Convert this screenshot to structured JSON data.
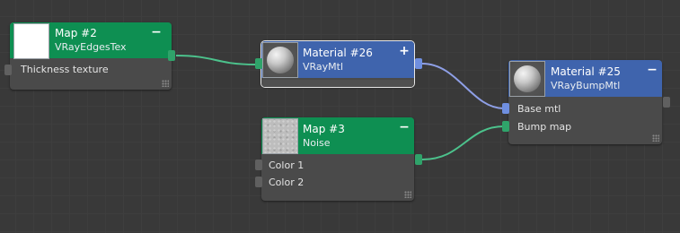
{
  "colors": {
    "canvas": "#393939",
    "node_body": "#4a4a4a",
    "map_header": "#0e8f52",
    "material_header": "#3f64ad",
    "wire_green": "#4cc28c",
    "wire_blue": "#8e9fe6"
  },
  "nodes": {
    "map2": {
      "title": "Map #2",
      "type": "VRayEdgesTex",
      "collapse_symbol": "−",
      "slots": [
        "Thickness texture"
      ],
      "thumbnail": "white-swatch"
    },
    "material26": {
      "title": "Material #26",
      "type": "VRayMtl",
      "expand_symbol": "+",
      "thumbnail": "sphere-preview"
    },
    "map3": {
      "title": "Map #3",
      "type": "Noise",
      "collapse_symbol": "−",
      "slots": [
        "Color 1",
        "Color 2"
      ],
      "thumbnail": "noise-swatch"
    },
    "material25": {
      "title": "Material #25",
      "type": "VRayBumpMtl",
      "collapse_symbol": "−",
      "slots": [
        "Base mtl",
        "Bump map"
      ],
      "thumbnail": "sphere-preview"
    }
  },
  "connections": [
    {
      "from": "Map #2",
      "to": "Material #26",
      "color": "green"
    },
    {
      "from": "Material #26",
      "to": "Material #25 / Base mtl",
      "color": "blue"
    },
    {
      "from": "Map #3",
      "to": "Material #25 / Bump map",
      "color": "green"
    }
  ]
}
